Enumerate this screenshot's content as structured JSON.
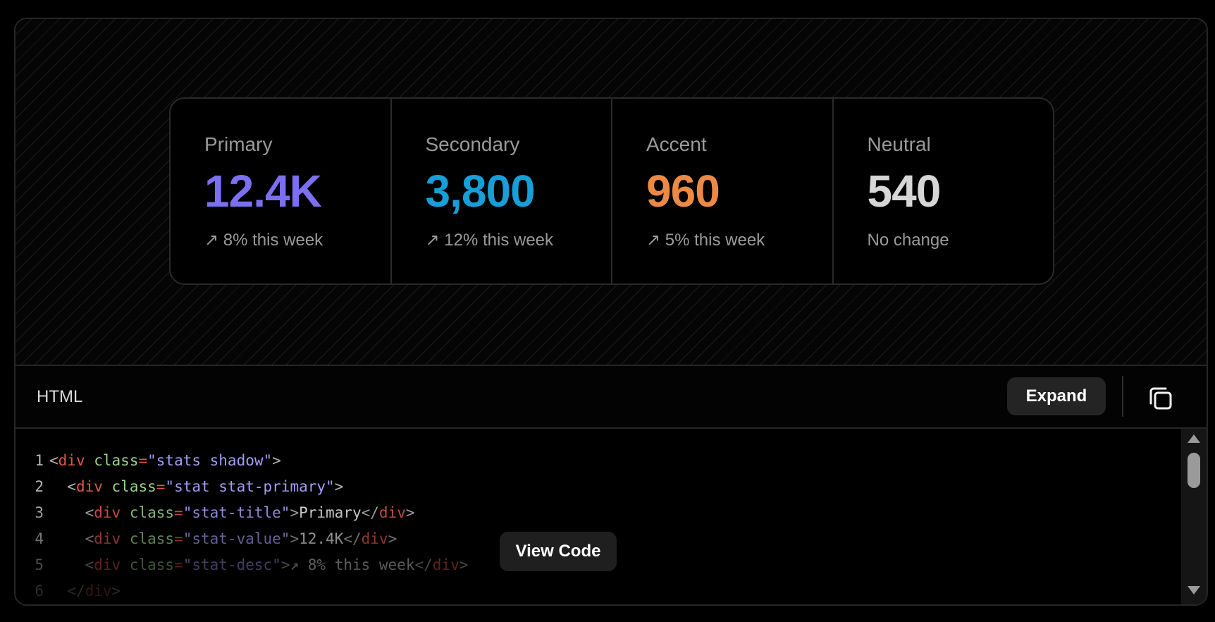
{
  "stats": [
    {
      "title": "Primary",
      "value": "12.4K",
      "desc": "↗ 8% this week",
      "color": "#7c6ff0"
    },
    {
      "title": "Secondary",
      "value": "3,800",
      "desc": "↗ 12% this week",
      "color": "#169fd8"
    },
    {
      "title": "Accent",
      "value": "960",
      "desc": "↗ 5% this week",
      "color": "#ec8a45"
    },
    {
      "title": "Neutral",
      "value": "540",
      "desc": "No change",
      "color": "#d6d6d6"
    }
  ],
  "code_panel": {
    "language": "HTML",
    "expand_label": "Expand",
    "copy_icon": "copy-icon",
    "view_code_label": "View Code",
    "lines": [
      {
        "n": "1",
        "indent": "",
        "tag": "div",
        "cls": "stats shadow",
        "text": "",
        "close": false,
        "bare_close": false
      },
      {
        "n": "2",
        "indent": "  ",
        "tag": "div",
        "cls": "stat stat-primary",
        "text": "",
        "close": false,
        "bare_close": false
      },
      {
        "n": "3",
        "indent": "    ",
        "tag": "div",
        "cls": "stat-title",
        "text": "Primary",
        "close": true,
        "bare_close": false
      },
      {
        "n": "4",
        "indent": "    ",
        "tag": "div",
        "cls": "stat-value",
        "text": "12.4K",
        "close": true,
        "bare_close": false
      },
      {
        "n": "5",
        "indent": "    ",
        "tag": "div",
        "cls": "stat-desc",
        "text": "↗ 8% this week",
        "close": true,
        "bare_close": false
      },
      {
        "n": "6",
        "indent": "  ",
        "tag": "div",
        "cls": "",
        "text": "",
        "close": false,
        "bare_close": true
      }
    ]
  }
}
